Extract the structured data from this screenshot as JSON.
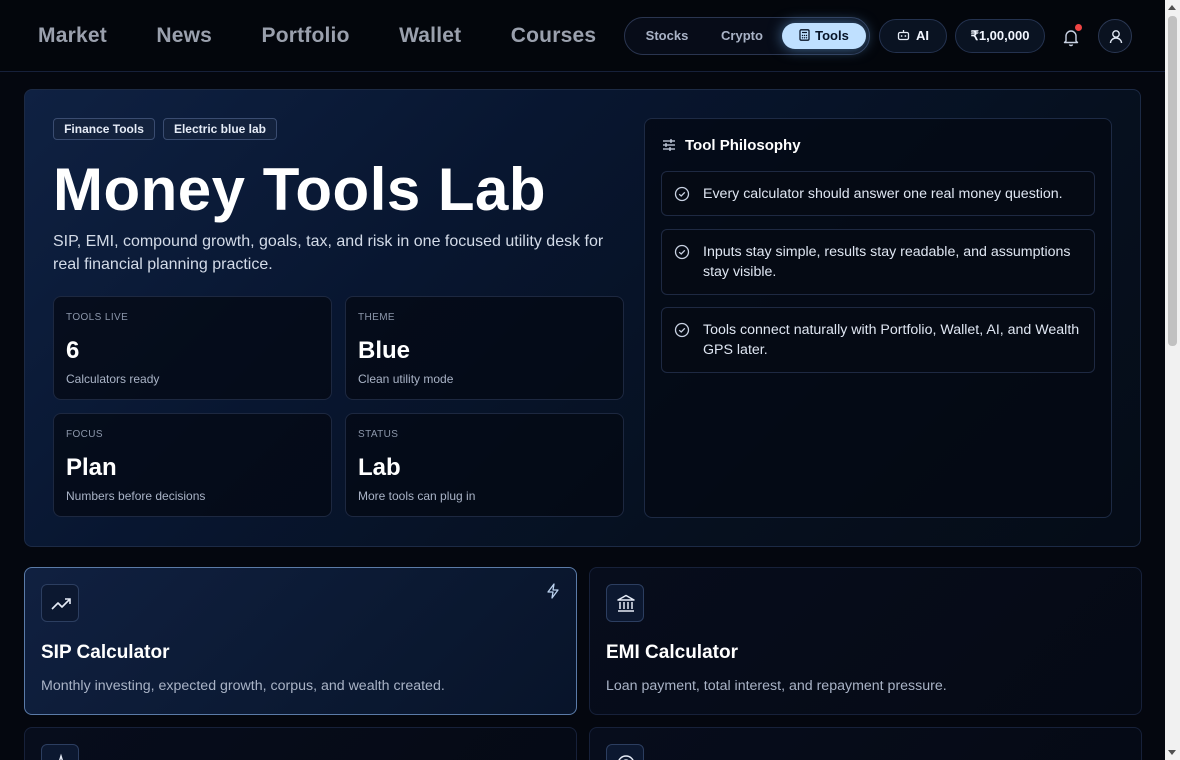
{
  "nav": {
    "links": [
      "Market",
      "News",
      "Portfolio",
      "Wallet",
      "Courses"
    ],
    "segment": {
      "options": [
        "Stocks",
        "Crypto",
        "Tools"
      ],
      "active": "Tools"
    },
    "ai_label": "AI",
    "balance": "₹1,00,000",
    "icons": {
      "ai": "robot-icon",
      "tools": "calculator-icon",
      "notifications": "bell-icon",
      "profile": "user-icon"
    }
  },
  "hero": {
    "tags": [
      "Finance Tools",
      "Electric blue lab"
    ],
    "title": "Money Tools Lab",
    "subtitle": "SIP, EMI, compound growth, goals, tax, and risk in one focused utility desk for real financial planning practice.",
    "stats": [
      {
        "label": "TOOLS LIVE",
        "value": "6",
        "caption": "Calculators ready"
      },
      {
        "label": "THEME",
        "value": "Blue",
        "caption": "Clean utility mode"
      },
      {
        "label": "FOCUS",
        "value": "Plan",
        "caption": "Numbers before decisions"
      },
      {
        "label": "STATUS",
        "value": "Lab",
        "caption": "More tools can plug in"
      }
    ]
  },
  "philosophy": {
    "title": "Tool Philosophy",
    "items": [
      "Every calculator should answer one real money question.",
      "Inputs stay simple, results stay readable, and assumptions stay visible.",
      "Tools connect naturally with Portfolio, Wallet, AI, and Wealth GPS later."
    ]
  },
  "tools": [
    {
      "name": "SIP Calculator",
      "desc": "Monthly investing, expected growth, corpus, and wealth created.",
      "icon": "trending-up-icon",
      "highlighted": true
    },
    {
      "name": "EMI Calculator",
      "desc": "Loan payment, total interest, and repayment pressure.",
      "icon": "bank-icon",
      "highlighted": false
    }
  ],
  "colors": {
    "accent": "#bfe0ff",
    "background": "#04070f",
    "notification_dot": "#ef4444"
  }
}
